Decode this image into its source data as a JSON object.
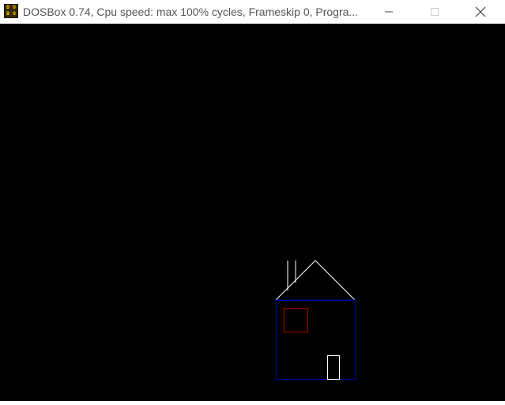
{
  "window": {
    "title": "DOSBox 0.74, Cpu speed: max 100% cycles, Frameskip  0, Progra...",
    "app_icon_letters": [
      "D",
      "O",
      "S",
      "B",
      "O",
      "X"
    ]
  },
  "controls": {
    "minimize_icon": "minimize-icon",
    "maximize_icon": "maximize-icon",
    "close_icon": "close-icon"
  },
  "colors": {
    "screen_background": "#000000",
    "roof": "#ffffff",
    "chimney": "#ffffff",
    "house_body": "#0000aa",
    "window": "#aa0000",
    "door": "#ffffff"
  }
}
